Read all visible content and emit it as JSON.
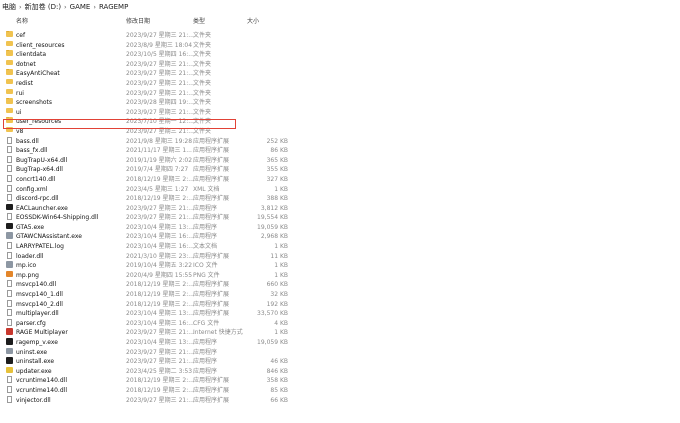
{
  "breadcrumb": [
    "电脑",
    "新加卷 (D:)",
    "GAME",
    "RAGEMP"
  ],
  "columns": {
    "name": "名称",
    "date": "修改日期",
    "type": "类型",
    "size": "大小"
  },
  "highlight_color": "#e14236",
  "files": [
    {
      "name": "cef",
      "date": "2023/9/27 星期三 21:...",
      "type": "文件夹",
      "size": "",
      "icon": "folder-icon"
    },
    {
      "name": "client_resources",
      "date": "2023/8/9 星期三 18:04",
      "type": "文件夹",
      "size": "",
      "icon": "folder-icon"
    },
    {
      "name": "clientdata",
      "date": "2023/10/5 星期四 16:...",
      "type": "文件夹",
      "size": "",
      "icon": "folder-icon"
    },
    {
      "name": "dotnet",
      "date": "2023/9/27 星期三 21:...",
      "type": "文件夹",
      "size": "",
      "icon": "folder-icon"
    },
    {
      "name": "EasyAntiCheat",
      "date": "2023/9/27 星期三 21:...",
      "type": "文件夹",
      "size": "",
      "icon": "folder-icon"
    },
    {
      "name": "redist",
      "date": "2023/9/27 星期三 21:...",
      "type": "文件夹",
      "size": "",
      "icon": "folder-icon"
    },
    {
      "name": "rui",
      "date": "2023/9/27 星期三 21:...",
      "type": "文件夹",
      "size": "",
      "icon": "folder-icon"
    },
    {
      "name": "screenshots",
      "date": "2023/9/28 星期四 19:...",
      "type": "文件夹",
      "size": "",
      "icon": "folder-icon"
    },
    {
      "name": "ui",
      "date": "2023/9/27 星期三 21:...",
      "type": "文件夹",
      "size": "",
      "icon": "folder-icon"
    },
    {
      "name": "user_resources",
      "date": "2023/7/10 星期一 12:...",
      "type": "文件夹",
      "size": "",
      "icon": "folder-icon"
    },
    {
      "name": "v8",
      "date": "2023/9/27 星期三 21:...",
      "type": "文件夹",
      "size": "",
      "icon": "folder-icon"
    },
    {
      "name": "bass.dll",
      "date": "2021/9/8 星期三 19:28",
      "type": "应用程序扩展",
      "size": "252 KB",
      "icon": "dll-file-icon"
    },
    {
      "name": "bass_fx.dll",
      "date": "2021/11/17 星期三 1...",
      "type": "应用程序扩展",
      "size": "86 KB",
      "icon": "dll-file-icon"
    },
    {
      "name": "BugTrapU-x64.dll",
      "date": "2019/1/19 星期六 2:02",
      "type": "应用程序扩展",
      "size": "365 KB",
      "icon": "dll-file-icon"
    },
    {
      "name": "BugTrap-x64.dll",
      "date": "2019/7/4 星期四 7:27",
      "type": "应用程序扩展",
      "size": "355 KB",
      "icon": "dll-file-icon"
    },
    {
      "name": "concrt140.dll",
      "date": "2018/12/19 星期三 2:...",
      "type": "应用程序扩展",
      "size": "327 KB",
      "icon": "dll-file-icon"
    },
    {
      "name": "config.xml",
      "date": "2023/4/5 星期三 1:27",
      "type": "XML 文档",
      "size": "1 KB",
      "icon": "xml-file-icon"
    },
    {
      "name": "discord-rpc.dll",
      "date": "2018/12/19 星期三 2:...",
      "type": "应用程序扩展",
      "size": "388 KB",
      "icon": "dll-file-icon"
    },
    {
      "name": "EACLauncher.exe",
      "date": "2023/9/27 星期三 21:...",
      "type": "应用程序",
      "size": "3,812 KB",
      "icon": "eac-launcher-icon"
    },
    {
      "name": "EOSSDK-Win64-Shipping.dll",
      "date": "2023/9/27 星期三 21:...",
      "type": "应用程序扩展",
      "size": "19,554 KB",
      "icon": "dll-file-icon"
    },
    {
      "name": "GTA5.exe",
      "date": "2023/10/4 星期三 13:...",
      "type": "应用程序",
      "size": "19,059 KB",
      "icon": "gta5-exe-icon"
    },
    {
      "name": "GTAWCNAssistant.exe",
      "date": "2023/10/4 星期三 16:...",
      "type": "应用程序",
      "size": "2,968 KB",
      "icon": "assistant-exe-icon"
    },
    {
      "name": "LARRYPATEL.log",
      "date": "2023/10/4 星期三 16:...",
      "type": "文本文档",
      "size": "1 KB",
      "icon": "text-file-icon"
    },
    {
      "name": "loader.dll",
      "date": "2021/3/10 星期三 23:...",
      "type": "应用程序扩展",
      "size": "11 KB",
      "icon": "dll-file-icon"
    },
    {
      "name": "mp.ico",
      "date": "2019/10/4 星期五 3:22",
      "type": "ICO 文件",
      "size": "1 KB",
      "icon": "ico-file-icon"
    },
    {
      "name": "mp.png",
      "date": "2020/4/9 星期四 15:55",
      "type": "PNG 文件",
      "size": "1 KB",
      "icon": "png-file-icon"
    },
    {
      "name": "msvcp140.dll",
      "date": "2018/12/19 星期三 2:...",
      "type": "应用程序扩展",
      "size": "660 KB",
      "icon": "dll-file-icon"
    },
    {
      "name": "msvcp140_1.dll",
      "date": "2018/12/19 星期三 2:...",
      "type": "应用程序扩展",
      "size": "32 KB",
      "icon": "dll-file-icon"
    },
    {
      "name": "msvcp140_2.dll",
      "date": "2018/12/19 星期三 2:...",
      "type": "应用程序扩展",
      "size": "192 KB",
      "icon": "dll-file-icon"
    },
    {
      "name": "multiplayer.dll",
      "date": "2023/10/4 星期三 13:...",
      "type": "应用程序扩展",
      "size": "33,570 KB",
      "icon": "dll-file-icon"
    },
    {
      "name": "parser.cfg",
      "date": "2023/10/4 星期三 16:...",
      "type": "CFG 文件",
      "size": "4 KB",
      "icon": "cfg-file-icon"
    },
    {
      "name": "RAGE Multiplayer",
      "date": "2023/9/27 星期三 21:...",
      "type": "Internet 快捷方式",
      "size": "1 KB",
      "icon": "rage-shortcut-icon"
    },
    {
      "name": "ragemp_v.exe",
      "date": "2023/10/4 星期三 13:...",
      "type": "应用程序",
      "size": "19,059 KB",
      "icon": "ragemp-exe-icon"
    },
    {
      "name": "uninst.exe",
      "date": "2023/9/27 星期三 21:...",
      "type": "应用程序",
      "size": "",
      "icon": "exe-file-icon"
    },
    {
      "name": "uninstall.exe",
      "date": "2023/9/27 星期三 21:...",
      "type": "应用程序",
      "size": "46 KB",
      "icon": "uninstall-exe-icon"
    },
    {
      "name": "updater.exe",
      "date": "2023/4/25 星期二 3:53",
      "type": "应用程序",
      "size": "846 KB",
      "icon": "updater-exe-icon"
    },
    {
      "name": "vcruntime140.dll",
      "date": "2018/12/19 星期三 2:...",
      "type": "应用程序扩展",
      "size": "358 KB",
      "icon": "dll-file-icon"
    },
    {
      "name": "vcruntime140.dll",
      "date": "2018/12/19 星期三 2:...",
      "type": "应用程序扩展",
      "size": "85 KB",
      "icon": "dll-file-icon"
    },
    {
      "name": "vinjector.dll",
      "date": "2023/9/27 星期三 21:...",
      "type": "应用程序扩展",
      "size": "66 KB",
      "icon": "dll-file-icon"
    }
  ]
}
